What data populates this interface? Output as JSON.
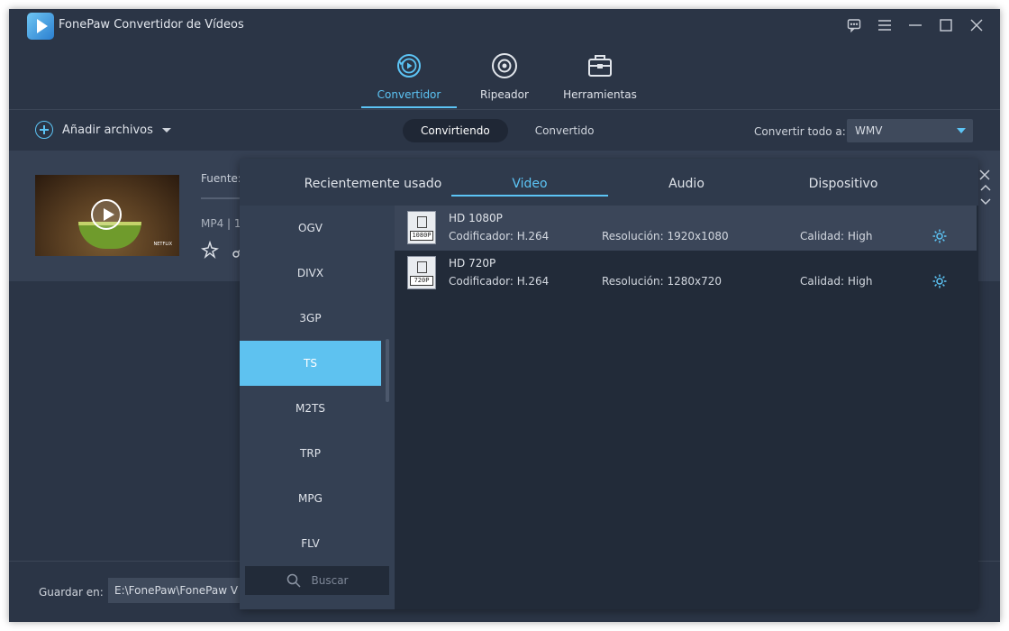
{
  "app": {
    "title": "FonePaw Convertidor de Vídeos"
  },
  "main_tabs": [
    {
      "label": "Convertidor",
      "icon": "convert-icon",
      "active": true
    },
    {
      "label": "Ripeador",
      "icon": "disc-icon",
      "active": false
    },
    {
      "label": "Herramientas",
      "icon": "toolbox-icon",
      "active": false
    }
  ],
  "toolbar": {
    "add_files": "Añadir archivos",
    "segments": [
      {
        "label": "Convirtiendo",
        "active": true
      },
      {
        "label": "Convertido",
        "active": false
      }
    ],
    "convert_all_label": "Convertir todo a:",
    "convert_all_value": "WMV"
  },
  "file": {
    "source_label": "Fuente:",
    "meta": "MP4 | 1",
    "thumb_watermark": "NETFLIX"
  },
  "bottom": {
    "save_label": "Guardar en:",
    "save_path": "E:\\FonePaw\\FonePaw V"
  },
  "popup": {
    "tabs": [
      {
        "label": "Recientemente usado",
        "active": false
      },
      {
        "label": "Video",
        "active": true
      },
      {
        "label": "Audio",
        "active": false
      },
      {
        "label": "Dispositivo",
        "active": false
      }
    ],
    "formats": [
      {
        "label": "OGV",
        "active": false
      },
      {
        "label": "DIVX",
        "active": false
      },
      {
        "label": "3GP",
        "active": false
      },
      {
        "label": "TS",
        "active": true
      },
      {
        "label": "M2TS",
        "active": false
      },
      {
        "label": "TRP",
        "active": false
      },
      {
        "label": "MPG",
        "active": false
      },
      {
        "label": "FLV",
        "active": false
      }
    ],
    "search_placeholder": "Buscar",
    "presets": [
      {
        "name": "HD 1080P",
        "badge": "1080P",
        "encoder": "Codificador: H.264",
        "resolution": "Resolución: 1920x1080",
        "quality": "Calidad: High",
        "active": true
      },
      {
        "name": "HD 720P",
        "badge": "720P",
        "encoder": "Codificador: H.264",
        "resolution": "Resolución: 1280x720",
        "quality": "Calidad: High",
        "active": false
      }
    ]
  },
  "colors": {
    "accent": "#5cc4f5",
    "background": "#2b3546",
    "panel": "#222b39",
    "selected_format": "#5ec2f0"
  }
}
